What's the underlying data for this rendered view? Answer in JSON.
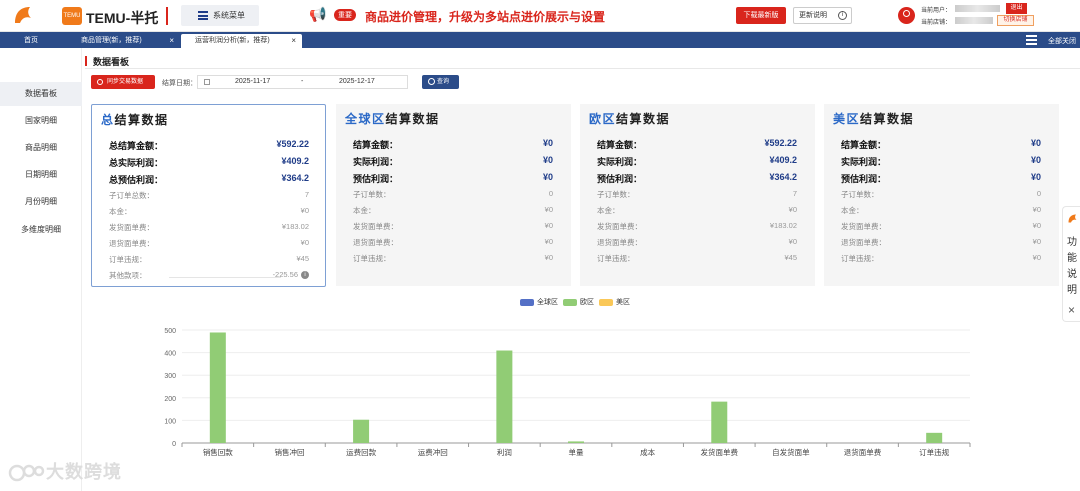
{
  "header": {
    "app_title": "TEMU-半托",
    "logo_small_text": "TEMU",
    "system_menu": "系统菜单",
    "notice_badge": "重要",
    "notice_text": "商品进价管理，升级为多站点进价展示与设置",
    "download_btn": "下载最新版",
    "update_btn": "更新说明",
    "info_glyph": "i",
    "current_user_label": "当前用户：",
    "current_store_label": "当前店铺：",
    "logout_btn": "退出",
    "switch_store_btn": "切换店铺",
    "accent": "#d9251c",
    "brand_blue": "#2b4c89"
  },
  "tabs": [
    {
      "label": "首页",
      "closable": false
    },
    {
      "label": "商品管理(新，推荐)",
      "closable": true
    },
    {
      "label": "运营利润分析(新，推荐)",
      "closable": true,
      "active": true
    }
  ],
  "tab_close_glyph": "×",
  "close_all": "全部关闭",
  "sidebar": {
    "items": [
      {
        "label": "数据看板",
        "active": true
      },
      {
        "label": "国家明细"
      },
      {
        "label": "商品明细"
      },
      {
        "label": "日期明细"
      },
      {
        "label": "月份明细"
      },
      {
        "label": "多维度明细"
      }
    ]
  },
  "section_title": "数据看板",
  "toolbar": {
    "sync_btn": "同步交易数据",
    "date_label": "结算日期：",
    "date_from": "2025-11-17",
    "date_sep": "-",
    "date_to": "2025-12-17",
    "query_btn": "查询"
  },
  "cards": {
    "total": {
      "title_hl": "总",
      "title_rest": "结算数据",
      "settle_label": "总结算金额：",
      "settle": "¥592.22",
      "actual_label": "总实际利润：",
      "actual": "¥409.2",
      "est_label": "总预估利润：",
      "est": "¥364.2",
      "orders_label": "子订单总数：",
      "orders": "7",
      "cost_label": "本金：",
      "cost": "¥0",
      "ship_label": "发货面单费：",
      "ship": "¥183.02",
      "return_label": "退货面单费：",
      "return": "¥0",
      "viol_label": "订单违规：",
      "viol": "¥45",
      "other_label": "其他款项：",
      "other": "-225.56"
    },
    "global": {
      "title_hl": "全球区",
      "title_rest": "结算数据",
      "settle_label": "结算金额：",
      "settle": "¥0",
      "actual_label": "实际利润：",
      "actual": "¥0",
      "est_label": "预估利润：",
      "est": "¥0",
      "orders_label": "子订单数：",
      "orders": "0",
      "cost_label": "本金：",
      "cost": "¥0",
      "ship_label": "发货面单费：",
      "ship": "¥0",
      "return_label": "退货面单费：",
      "return": "¥0",
      "viol_label": "订单违规：",
      "viol": "¥0"
    },
    "eu": {
      "title_hl": "欧区",
      "title_rest": "结算数据",
      "settle_label": "结算金额：",
      "settle": "¥592.22",
      "actual_label": "实际利润：",
      "actual": "¥409.2",
      "est_label": "预估利润：",
      "est": "¥364.2",
      "orders_label": "子订单数：",
      "orders": "7",
      "cost_label": "本金：",
      "cost": "¥0",
      "ship_label": "发货面单费：",
      "ship": "¥183.02",
      "return_label": "退货面单费：",
      "return": "¥0",
      "viol_label": "订单违规：",
      "viol": "¥45"
    },
    "us": {
      "title_hl": "美区",
      "title_rest": "结算数据",
      "settle_label": "结算金额：",
      "settle": "¥0",
      "actual_label": "实际利润：",
      "actual": "¥0",
      "est_label": "预估利润：",
      "est": "¥0",
      "orders_label": "子订单数：",
      "orders": "0",
      "cost_label": "本金：",
      "cost": "¥0",
      "ship_label": "发货面单费：",
      "ship": "¥0",
      "return_label": "退货面单费：",
      "return": "¥0",
      "viol_label": "订单违规：",
      "viol": "¥0"
    }
  },
  "right_float": {
    "label": "功能说明",
    "close": "×"
  },
  "watermark": "大数跨境",
  "chart_data": {
    "type": "bar",
    "categories": [
      "销售回款",
      "销售冲回",
      "运费回款",
      "运费冲回",
      "利润",
      "单量",
      "成本",
      "发货面单费",
      "自发货面单",
      "退货面单费",
      "订单违规"
    ],
    "series": [
      {
        "name": "全球区",
        "color": "#5470c6",
        "values": [
          0,
          0,
          0,
          0,
          0,
          0,
          0,
          0,
          0,
          0,
          0
        ]
      },
      {
        "name": "欧区",
        "color": "#91cc75",
        "values": [
          489,
          0,
          103,
          0,
          409.2,
          7,
          0,
          183.02,
          0,
          0,
          45
        ]
      },
      {
        "name": "美区",
        "color": "#fac858",
        "values": [
          0,
          0,
          0,
          0,
          0,
          0,
          0,
          0,
          0,
          0,
          0
        ]
      }
    ],
    "ylim": [
      0,
      500
    ],
    "yticks": [
      0,
      100,
      200,
      300,
      400,
      500
    ],
    "legend_position": "top-center",
    "grid": true
  }
}
